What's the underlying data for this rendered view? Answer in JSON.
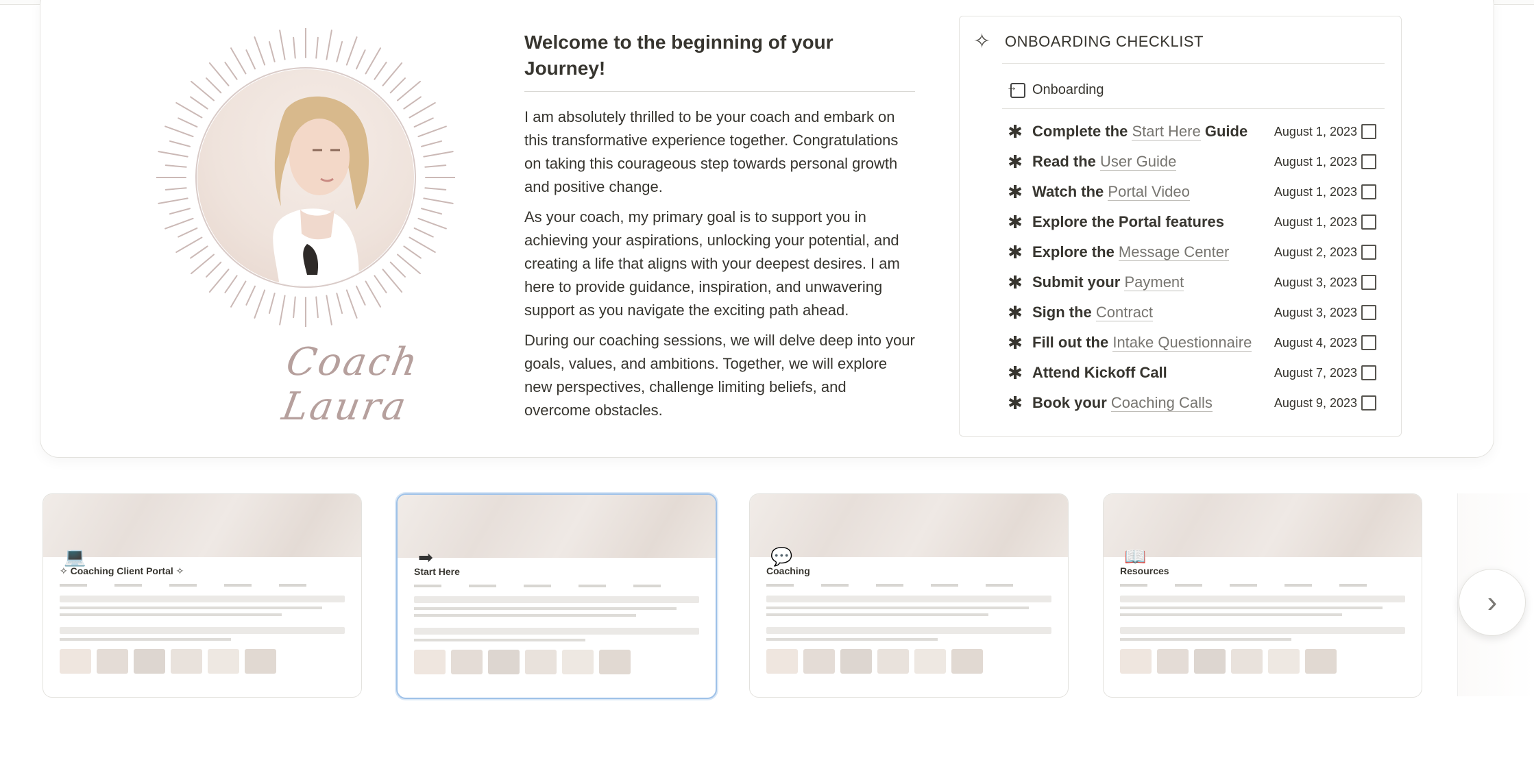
{
  "welcome": {
    "heading": "Welcome to the beginning of your Journey!",
    "paragraphs": [
      "I am absolutely thrilled to be your coach and embark on this transformative experience together. Congratulations on taking this courageous step towards personal growth and positive change.",
      "As your coach, my primary goal is to support you in achieving your aspirations, unlocking your potential, and creating a life that aligns with your deepest desires. I am here to provide guidance, inspiration, and unwavering support as you navigate the exciting path ahead.",
      "During our coaching sessions, we will delve deep into your goals, values, and ambitions. Together, we will explore new perspectives, challenge limiting beliefs, and overcome obstacles."
    ]
  },
  "signature": "Coach Laura",
  "checklist": {
    "title": "ONBOARDING CHECKLIST",
    "view_name": "Onboarding",
    "items": [
      {
        "prefix": "Complete the ",
        "link": "Start Here",
        "suffix": " Guide",
        "date": "August 1, 2023"
      },
      {
        "prefix": "Read the ",
        "link": "User Guide",
        "suffix": "",
        "date": "August 1, 2023"
      },
      {
        "prefix": "Watch the ",
        "link": "Portal Video",
        "suffix": "",
        "date": "August 1, 2023"
      },
      {
        "prefix": "Explore the Portal features",
        "link": "",
        "suffix": "",
        "date": "August 1, 2023"
      },
      {
        "prefix": "Explore the ",
        "link": "Message Center",
        "suffix": "",
        "date": "August 2, 2023"
      },
      {
        "prefix": "Submit your ",
        "link": "Payment",
        "suffix": "",
        "date": "August 3, 2023"
      },
      {
        "prefix": "Sign the ",
        "link": "Contract",
        "suffix": "",
        "date": "August 3, 2023"
      },
      {
        "prefix": "Fill out the ",
        "link": "Intake Questionnaire",
        "suffix": "",
        "date": "August 4, 2023"
      },
      {
        "prefix": "Attend Kickoff Call",
        "link": "",
        "suffix": "",
        "date": "August 7, 2023"
      },
      {
        "prefix": "Book your ",
        "link": "Coaching Calls",
        "suffix": "",
        "date": "August 9, 2023"
      }
    ]
  },
  "gallery": {
    "cards": [
      {
        "title": "✧ Coaching Client Portal ✧",
        "icon": "laptop-check-icon",
        "selected": false
      },
      {
        "title": "Start Here",
        "icon": "arrow-right-icon",
        "selected": true
      },
      {
        "title": "Coaching",
        "icon": "speech-bubbles-icon",
        "selected": false
      },
      {
        "title": "Resources",
        "icon": "open-book-icon",
        "selected": false
      }
    ],
    "next_label": "›"
  }
}
